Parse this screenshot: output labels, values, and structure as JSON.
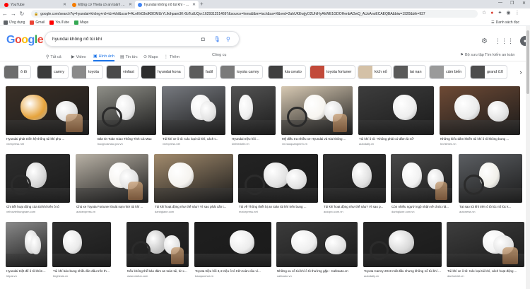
{
  "browser": {
    "tabs": [
      {
        "title": "YouTube",
        "favicon_color": "#ff0000",
        "active": false
      },
      {
        "title": "Động cơ Theta có an toàn! Mua...",
        "favicon_color": "#f57c00",
        "active": false
      },
      {
        "title": "hyundai không nổ túi khí - Goo...",
        "favicon_color": "#4285f4",
        "active": true
      }
    ],
    "new_tab": "+",
    "url": "google.com/search?q=hyundai+không+nổ+túi+khí&sxsrf=ALeKk03rdKBOMUrYLlkthpam3K-6bTcdUQw:1629312514697&source=lnms&tbm=isch&sa=X&ved=2ahUKEwjjyO2UhIHyAhWE1GDOHenbADwQ_AUoAnoECAEQBA&biw=1920&bih=937",
    "bookmarks": [
      {
        "label": "Ứng dụng",
        "color": "#5f6368"
      },
      {
        "label": "Gmail",
        "color": "#ea4335"
      },
      {
        "label": "YouTube",
        "color": "#ff0000"
      },
      {
        "label": "Maps",
        "color": "#34a853"
      }
    ],
    "reading_list": "Danh sách đọc"
  },
  "search": {
    "query": "hyundai không nổ túi khí",
    "tabs": [
      {
        "label": "Tất cả",
        "icon": "search-icon",
        "active": false
      },
      {
        "label": "Video",
        "icon": "video-icon",
        "active": false
      },
      {
        "label": "Hình ảnh",
        "icon": "image-icon",
        "active": true
      },
      {
        "label": "Tin tức",
        "icon": "news-icon",
        "active": false
      },
      {
        "label": "Maps",
        "icon": "map-pin-icon",
        "active": false
      },
      {
        "label": "Thêm",
        "icon": "more-icon",
        "active": false
      }
    ],
    "tools": "Công cụ",
    "saved": "Bộ sưu tập",
    "safesearch": "Tìm kiếm an toàn"
  },
  "chips": [
    {
      "label": "ô tô",
      "color": "#6d6d6d"
    },
    {
      "label": "camry",
      "color": "#3b3b3b"
    },
    {
      "label": "toyota",
      "color": "#8a8a8a"
    },
    {
      "label": "vinfast",
      "color": "#4a4a4a"
    },
    {
      "label": "hyundai kona",
      "color": "#2d2d2d"
    },
    {
      "label": "fadil",
      "color": "#5c5c5c"
    },
    {
      "label": "toyota camry",
      "color": "#7a7a7a"
    },
    {
      "label": "kia cerato",
      "color": "#3f3f3f"
    },
    {
      "label": "toyota fortuner",
      "color": "#c24a3a"
    },
    {
      "label": "kích nổ",
      "color": "#d4c1a7"
    },
    {
      "label": "tai nạn",
      "color": "#5a5a5a"
    },
    {
      "label": "cảm biến",
      "color": "#9a9a9a"
    },
    {
      "label": "grand i10",
      "color": "#4d4d4d"
    }
  ],
  "images": [
    {
      "caption": "Hyundai phát triển hệ thống túi khí phụ ...",
      "source": "vnexpress.net",
      "bg": "#3b3027",
      "accent": "#e6a33b"
    },
    {
      "caption": "Bản tin Toàn Giao Thông Tỉnh Cà Mau",
      "source": "baogt.camau.gov.vn",
      "bg": "#8f8f88",
      "accent": "#e9e9e9"
    },
    {
      "caption": "Túi khí xe ô tô: Các loại túi khí, cách t...",
      "source": "vnexpress.net",
      "bg": "#777a80",
      "accent": "#f1f1f1"
    },
    {
      "caption": "Hyundai triệu hồi ...",
      "source": "kinhtedothi.vn",
      "bg": "#545454",
      "accent": "#efefef"
    },
    {
      "caption": "Mỹ điều tra nhiều xe Hyundai và Kia không ...",
      "source": "vn.baoquangninh.vn",
      "bg": "#d7c9b3",
      "accent": "#f7f5f0"
    },
    {
      "caption": "Túi khí ô tô: \"Không phải cứ đâm là nổ\"",
      "source": "autodaily.vn",
      "bg": "#3d3d3d",
      "accent": "#eeeeee"
    },
    {
      "caption": "Những kiểu đâm khiến túi khí ô tô không bung ...",
      "source": "techtimes.vn",
      "bg": "#6e4a35",
      "accent": "#ebebeb"
    },
    {
      "caption": "Chi tiết hoạt động của túi khí trên ô tô",
      "source": "xehoiviethungnam.com",
      "bg": "#2e2e2e",
      "accent": "#d7d7d7"
    },
    {
      "caption": "Chủ xe Toyota Fortuner thoát nạn nhờ túi khí ...",
      "source": "autoexpress.vn",
      "bg": "#b9b2a6",
      "accent": "#f4f2ee"
    },
    {
      "caption": "Túi khí hoạt động như thế nào? Vì sao phải cẩn t...",
      "source": "danhgiaxe.com",
      "bg": "#a28b6d",
      "accent": "#f5f3ef"
    },
    {
      "caption": "Túi về Thông thiết bị an toàn túi khí trên bung ...",
      "source": "motorpress.net",
      "bg": "#232323",
      "accent": "#e2e2e2"
    },
    {
      "caption": "Túi khí hoạt động như thế nào? Vì sao p...",
      "source": "autopro.com.vn",
      "bg": "#313131",
      "accent": "#e0e0e0"
    },
    {
      "caption": "Còn nhiều người ngộ nhận về chức nă...",
      "source": "danhgiaxe.com.vn",
      "bg": "#4a4a4a",
      "accent": "#f1f1f1"
    },
    {
      "caption": "Tại sao túi khí trên ô tô lúc nổ lúc k...",
      "source": "autonews.vn",
      "bg": "#5c5f63",
      "accent": "#f0efe9"
    },
    {
      "caption": "Hyundai triệt để ô tô không ...",
      "source": "hitpai.vn",
      "bg": "#8a8a8a",
      "accent": "#dedede"
    },
    {
      "caption": "Túi khí bảo bung nhiều lần đâu trên thế giới ...",
      "source": "tinghesis.vn",
      "bg": "#2f2f2f",
      "accent": "#eaeaea"
    },
    {
      "caption": "Nếu không thể bảo đảm an toàn túi, từ xe ...",
      "source": "www.otofun.com",
      "bg": "#2a2a2a",
      "accent": "#c9c9c9"
    },
    {
      "caption": "Toyota triệu hồi 3,4 triệu ô tô trên toàn cầu vì...",
      "source": "baoquochoi.vn",
      "bg": "#1f1f1f",
      "accent": "#ececec"
    },
    {
      "caption": "Những xu cố túi khí ô tô thường gặp - Cafeauto.vn",
      "source": "cafeauto.vn",
      "bg": "#3c3c3c",
      "accent": "#eeeeee"
    },
    {
      "caption": "Toyota Camry 2019 mất đầu nhưng không nổ túi khí ...",
      "source": "autodaily.vn",
      "bg": "#262626",
      "accent": "#d9d9d9"
    },
    {
      "caption": "Túi khí xe ô tô: Các loại túi khí, cách hoạt động ...",
      "source": "danhoiviet.vn",
      "bg": "#3e3e3e",
      "accent": "#f2f2f2"
    }
  ]
}
